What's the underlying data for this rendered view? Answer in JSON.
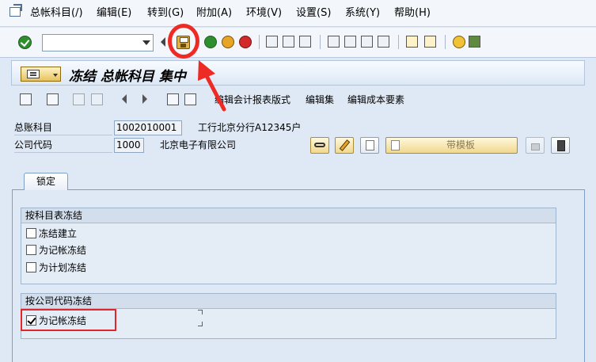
{
  "menubar": {
    "items": [
      {
        "id": "gl",
        "label": "总帐科目(/)"
      },
      {
        "id": "edit",
        "label": "编辑(E)"
      },
      {
        "id": "goto",
        "label": "转到(G)"
      },
      {
        "id": "extras",
        "label": "附加(A)"
      },
      {
        "id": "env",
        "label": "环境(V)"
      },
      {
        "id": "settings",
        "label": "设置(S)"
      },
      {
        "id": "system",
        "label": "系统(Y)"
      },
      {
        "id": "help",
        "label": "帮助(H)"
      }
    ]
  },
  "toolbar": {
    "command_value": ""
  },
  "title": {
    "text": "冻结 总帐科目 集中"
  },
  "app_toolbar": {
    "edit_fs_version": "编辑会计报表版式",
    "edit_set": "编辑集",
    "edit_cost_element": "编辑成本要素"
  },
  "header": {
    "gl_account_label": "总账科目",
    "gl_account_value": "1002010001",
    "gl_account_desc": "工行北京分行A12345户",
    "company_code_label": "公司代码",
    "company_code_value": "1000",
    "company_code_desc": "北京电子有限公司",
    "template_button_label": "带模板"
  },
  "tabs": [
    {
      "label": "锁定"
    }
  ],
  "groups": {
    "chart_of_accounts": {
      "title": "按科目表冻结",
      "options": [
        {
          "label": "冻结建立",
          "checked": false
        },
        {
          "label": "为记帐冻结",
          "checked": false
        },
        {
          "label": "为计划冻结",
          "checked": false
        }
      ]
    },
    "company_code": {
      "title": "按公司代码冻结",
      "options": [
        {
          "label": "为记帐冻结",
          "checked": true
        }
      ]
    }
  },
  "colors": {
    "annotation": "#ee2a24",
    "background": "#dfe9f5"
  }
}
